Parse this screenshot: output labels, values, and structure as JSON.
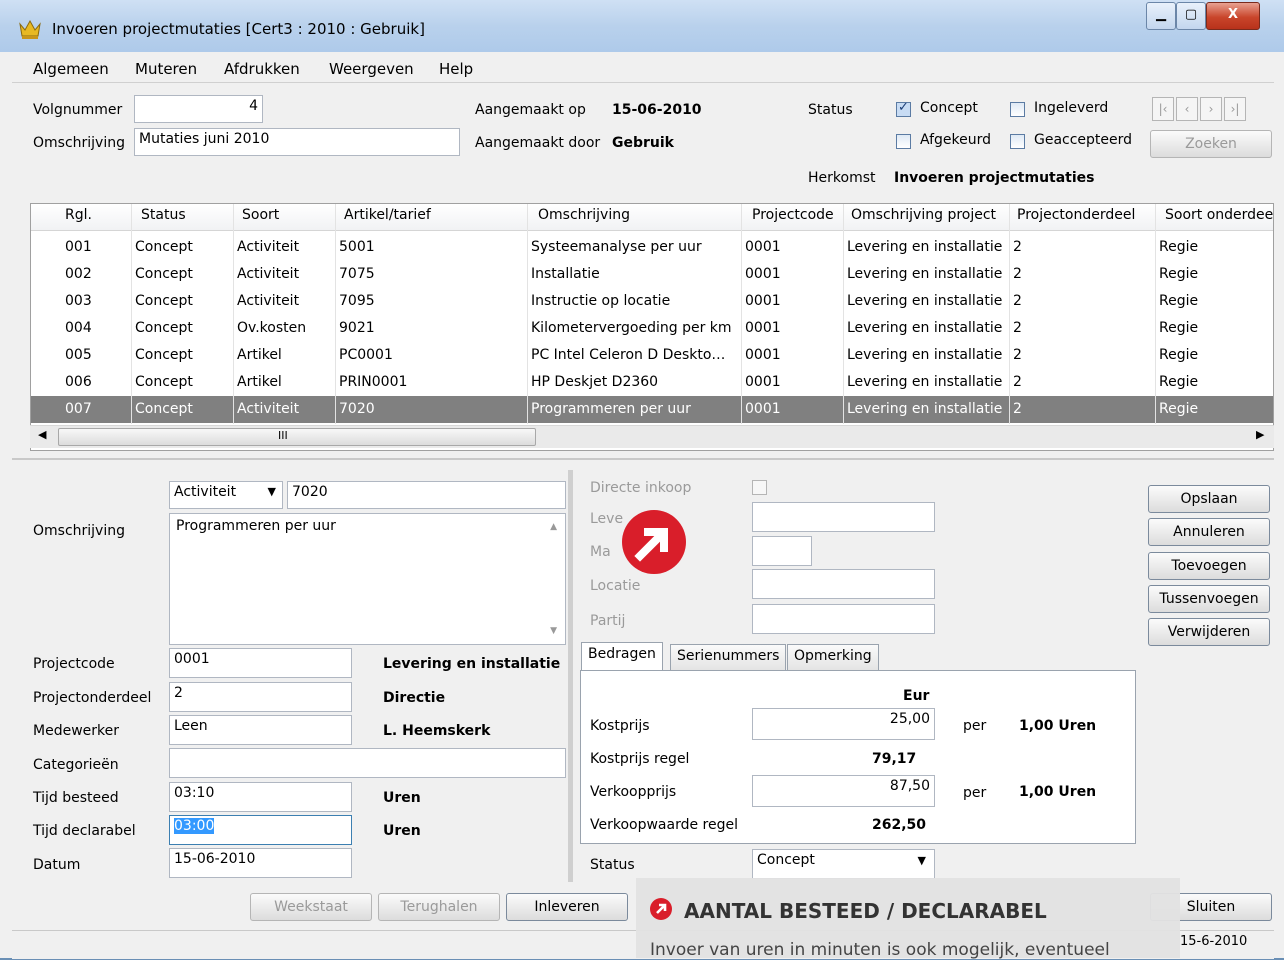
{
  "window": {
    "title": "Invoeren projectmutaties  [Cert3 : 2010 : Gebruik]"
  },
  "menu": [
    "Algemeen",
    "Muteren",
    "Afdrukken",
    "Weergeven",
    "Help"
  ],
  "header": {
    "volgnummer_label": "Volgnummer",
    "volgnummer_value": "4",
    "omschrijving_label": "Omschrijving",
    "omschrijving_value": "Mutaties juni 2010",
    "aangemaakt_op_label": "Aangemaakt op",
    "aangemaakt_op_value": "15-06-2010",
    "aangemaakt_door_label": "Aangemaakt door",
    "aangemaakt_door_value": "Gebruik",
    "status_label": "Status",
    "cb_concept": "Concept",
    "cb_ingeleverd": "Ingeleverd",
    "cb_afgekeurd": "Afgekeurd",
    "cb_geaccepteerd": "Geaccepteerd",
    "zoeken": "Zoeken",
    "herkomst_label": "Herkomst",
    "herkomst_value": "Invoeren projectmutaties"
  },
  "grid": {
    "headers": [
      "Rgl.",
      "Status",
      "Soort",
      "Artikel/tarief",
      "Omschrijving",
      "Projectcode",
      "Omschrijving project",
      "Projectonderdeel",
      "Soort onderdee"
    ],
    "rows": [
      [
        "001",
        "Concept",
        "Activiteit",
        "5001",
        "Systeemanalyse per uur",
        "0001",
        "Levering en installatie",
        "2",
        "Regie"
      ],
      [
        "002",
        "Concept",
        "Activiteit",
        "7075",
        "Installatie",
        "0001",
        "Levering en installatie",
        "2",
        "Regie"
      ],
      [
        "003",
        "Concept",
        "Activiteit",
        "7095",
        "Instructie op locatie",
        "0001",
        "Levering en installatie",
        "2",
        "Regie"
      ],
      [
        "004",
        "Concept",
        "Ov.kosten",
        "9021",
        "Kilometervergoeding per km",
        "0001",
        "Levering en installatie",
        "2",
        "Regie"
      ],
      [
        "005",
        "Concept",
        "Artikel",
        "PC0001",
        "PC Intel Celeron D Deskto…",
        "0001",
        "Levering en installatie",
        "2",
        "Regie"
      ],
      [
        "006",
        "Concept",
        "Artikel",
        "PRIN0001",
        "HP Deskjet D2360",
        "0001",
        "Levering en installatie",
        "2",
        "Regie"
      ],
      [
        "007",
        "Concept",
        "Activiteit",
        "7020",
        "Programmeren per uur",
        "0001",
        "Levering en installatie",
        "2",
        "Regie"
      ]
    ],
    "scroll_mid": "III"
  },
  "detail": {
    "soort_value": "Activiteit",
    "artikel_value": "7020",
    "omschrijving_label": "Omschrijving",
    "omschrijving_value": "Programmeren per uur",
    "projectcode_label": "Projectcode",
    "projectcode_value": "0001",
    "projectcode_desc": "Levering en installatie",
    "projectonderdeel_label": "Projectonderdeel",
    "projectonderdeel_value": "2",
    "projectonderdeel_desc": "Directie",
    "medewerker_label": "Medewerker",
    "medewerker_value": "Leen",
    "medewerker_desc": "L. Heemskerk",
    "categorieen_label": "Categorieën",
    "tijd_besteed_label": "Tijd besteed",
    "tijd_besteed_value": "03:10",
    "tijd_besteed_unit": "Uren",
    "tijd_declarabel_label": "Tijd declarabel",
    "tijd_declarabel_value": "03:00",
    "tijd_declarabel_unit": "Uren",
    "datum_label": "Datum",
    "datum_value": "15-06-2010"
  },
  "right": {
    "directe_inkoop": "Directe inkoop",
    "leverancier": "Leve",
    "magazijn": "Ma",
    "locatie": "Locatie",
    "partij": "Partij",
    "tabs": [
      "Bedragen",
      "Serienummers",
      "Opmerking"
    ],
    "currency": "Eur",
    "kostprijs_label": "Kostprijs",
    "kostprijs_value": "25,00",
    "per1": "per",
    "kostprijs_unit": "1,00 Uren",
    "kostprijs_regel_label": "Kostprijs regel",
    "kostprijs_regel_value": "79,17",
    "verkoopprijs_label": "Verkoopprijs",
    "verkoopprijs_value": "87,50",
    "per2": "per",
    "verkoopprijs_unit": "1,00 Uren",
    "verkoopwaarde_label": "Verkoopwaarde regel",
    "verkoopwaarde_value": "262,50",
    "status_label": "Status",
    "status_value": "Concept"
  },
  "actions": [
    "Opslaan",
    "Annuleren",
    "Toevoegen",
    "Tussenvoegen",
    "Verwijderen"
  ],
  "bottom": {
    "weekstaat": "Weekstaat",
    "terughalen": "Terughalen",
    "inleveren": "Inleveren",
    "sluiten": "Sluiten",
    "date": "15-6-2010"
  },
  "callout": {
    "title": "AANTAL BESTEED / DECLARABEL",
    "text": "Invoer van uren in minuten is ook mogelijk, eventueel"
  },
  "colors": {
    "selection": "#808080",
    "accent": "#d91e2a"
  }
}
